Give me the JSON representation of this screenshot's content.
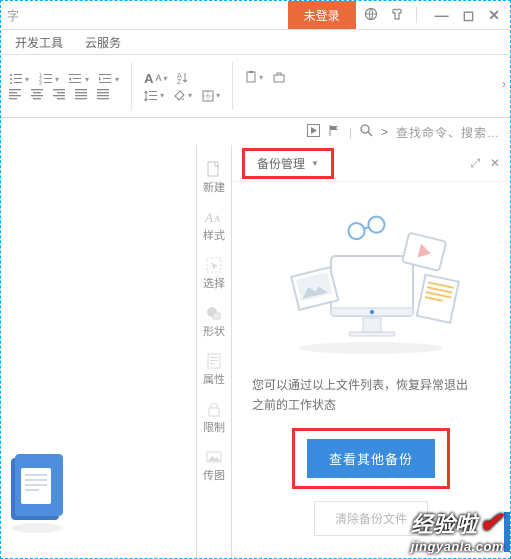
{
  "titlebar": {
    "left_text": "字",
    "login_badge": "未登录"
  },
  "menus": {
    "dev_tools": "开发工具",
    "cloud": "云服务"
  },
  "command_bar": {
    "search_prefix": ">",
    "search_placeholder": "查找命令、搜索…"
  },
  "rail": {
    "new": "新建",
    "style": "样式",
    "select": "选择",
    "shape": "形状",
    "property": "属性",
    "restrict": "限制",
    "legend": "传图"
  },
  "panel": {
    "title": "备份管理",
    "message_line1": "您可以通过以上文件列表，恢复异常退出",
    "message_line2": "之前的工作状态",
    "view_other": "查看其他备份",
    "clear": "清除备份文件"
  },
  "watermark": {
    "brand": "经验啦",
    "url": "jingyanla.com"
  }
}
